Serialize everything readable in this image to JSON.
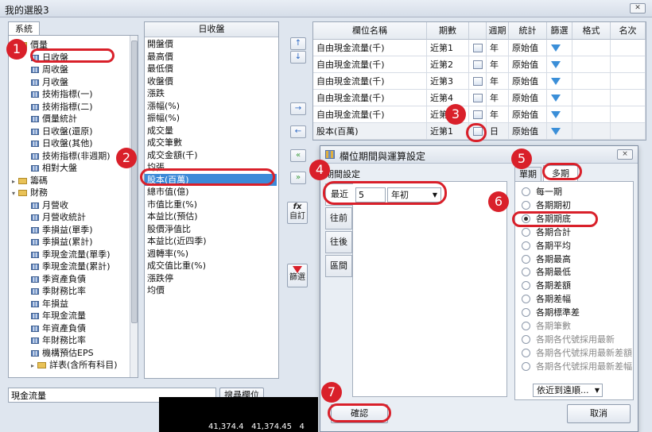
{
  "window": {
    "title": "我的選股3"
  },
  "left": {
    "tab_label": "系統",
    "tree": [
      {
        "label": "價量",
        "type": "folder",
        "indent": 0
      },
      {
        "label": "日收盤",
        "type": "table",
        "indent": 1
      },
      {
        "label": "周收盤",
        "type": "table",
        "indent": 1
      },
      {
        "label": "月收盤",
        "type": "table",
        "indent": 1
      },
      {
        "label": "技術指標(一)",
        "type": "table",
        "indent": 1
      },
      {
        "label": "技術指標(二)",
        "type": "table",
        "indent": 1
      },
      {
        "label": "價量統計",
        "type": "table",
        "indent": 1
      },
      {
        "label": "日收盤(還原)",
        "type": "table",
        "indent": 1
      },
      {
        "label": "日收盤(其他)",
        "type": "table",
        "indent": 1
      },
      {
        "label": "技術指標(非週期)",
        "type": "table",
        "indent": 1
      },
      {
        "label": "相對大盤",
        "type": "table",
        "indent": 1
      },
      {
        "label": "籌碼",
        "type": "folder",
        "indent": 0
      },
      {
        "label": "財務",
        "type": "folder",
        "indent": 0
      },
      {
        "label": "月營收",
        "type": "table",
        "indent": 1
      },
      {
        "label": "月營收統計",
        "type": "table",
        "indent": 1
      },
      {
        "label": "季損益(單季)",
        "type": "table",
        "indent": 1
      },
      {
        "label": "季損益(累計)",
        "type": "table",
        "indent": 1
      },
      {
        "label": "季現金流量(單季)",
        "type": "table",
        "indent": 1
      },
      {
        "label": "季現金流量(累計)",
        "type": "table",
        "indent": 1
      },
      {
        "label": "季資產負債",
        "type": "table",
        "indent": 1
      },
      {
        "label": "季財務比率",
        "type": "table",
        "indent": 1
      },
      {
        "label": "年損益",
        "type": "table",
        "indent": 1
      },
      {
        "label": "年現金流量",
        "type": "table",
        "indent": 1
      },
      {
        "label": "年資產負債",
        "type": "table",
        "indent": 1
      },
      {
        "label": "年財務比率",
        "type": "table",
        "indent": 1
      },
      {
        "label": "機構預估EPS",
        "type": "table",
        "indent": 1
      },
      {
        "label": "詳表(含所有科目)",
        "type": "folder",
        "indent": 1
      }
    ],
    "search_value": "現金流量",
    "search_button": "搜尋欄位"
  },
  "middle": {
    "header": "日收盤",
    "items": [
      "開盤價",
      "最高價",
      "最低價",
      "收盤價",
      "漲跌",
      "漲幅(%)",
      "振幅(%)",
      "成交量",
      "成交筆數",
      "成交金額(千)",
      "均張",
      "股本(百萬)",
      "總市值(億)",
      "市值比重(%)",
      "本益比(預估)",
      "股價淨值比",
      "本益比(近四季)",
      "週轉率(%)",
      "成交值比重(%)",
      "漲跌停",
      "均價"
    ],
    "selected_index": 11
  },
  "side_buttons": {
    "up": "↑",
    "down": "↓",
    "add": "→",
    "remove": "←",
    "add_all": "»",
    "remove_all": "«",
    "custom_label": "自訂",
    "custom_icon_text": "fx",
    "filter_label": "篩選"
  },
  "grid": {
    "headers": [
      "欄位名稱",
      "期數",
      "",
      "週期",
      "統計",
      "篩選",
      "格式",
      "名次"
    ],
    "rows": [
      {
        "name": "自由現金流量(千)",
        "period": "近第1",
        "cycle": "年",
        "stat": "原始值"
      },
      {
        "name": "自由現金流量(千)",
        "period": "近第2",
        "cycle": "年",
        "stat": "原始值"
      },
      {
        "name": "自由現金流量(千)",
        "period": "近第3",
        "cycle": "年",
        "stat": "原始值"
      },
      {
        "name": "自由現金流量(千)",
        "period": "近第4",
        "cycle": "年",
        "stat": "原始值"
      },
      {
        "name": "自由現金流量(千)",
        "period": "近第5",
        "cycle": "年",
        "stat": "原始值"
      },
      {
        "name": "股本(百萬)",
        "period": "近第1",
        "cycle": "日",
        "stat": "原始值"
      }
    ]
  },
  "dialog": {
    "title": "欄位期間與運算設定",
    "close": "×",
    "section_label": "期間設定",
    "vtabs": [
      "最近",
      "往前",
      "往後",
      "區間"
    ],
    "recent_value": "5",
    "recent_unit": "年初",
    "tabs": [
      "單期",
      "多期"
    ],
    "options": [
      {
        "label": "每一期",
        "state": "normal"
      },
      {
        "label": "各期期初",
        "state": "normal"
      },
      {
        "label": "各期期底",
        "state": "checked"
      },
      {
        "label": "各期合計",
        "state": "normal"
      },
      {
        "label": "各期平均",
        "state": "normal"
      },
      {
        "label": "各期最高",
        "state": "normal"
      },
      {
        "label": "各期最低",
        "state": "normal"
      },
      {
        "label": "各期差額",
        "state": "normal"
      },
      {
        "label": "各期差幅",
        "state": "normal"
      },
      {
        "label": "各期標準差",
        "state": "normal"
      },
      {
        "label": "各期筆數",
        "state": "disabled"
      },
      {
        "label": "各期各代號採用最新",
        "state": "disabled"
      },
      {
        "label": "各期各代號採用最新差額",
        "state": "disabled"
      },
      {
        "label": "各期各代號採用最新差幅",
        "state": "disabled"
      }
    ],
    "sort_dropdown": "依近到遠順...",
    "ok": "確認",
    "cancel": "取消"
  },
  "markers": [
    "1",
    "2",
    "3",
    "4",
    "5",
    "6",
    "7"
  ],
  "bottom_numbers": [
    "41,374.4",
    "41,374.45",
    "4"
  ],
  "colors": {
    "accent": "#3c8ad8",
    "marker": "#d9202a"
  }
}
